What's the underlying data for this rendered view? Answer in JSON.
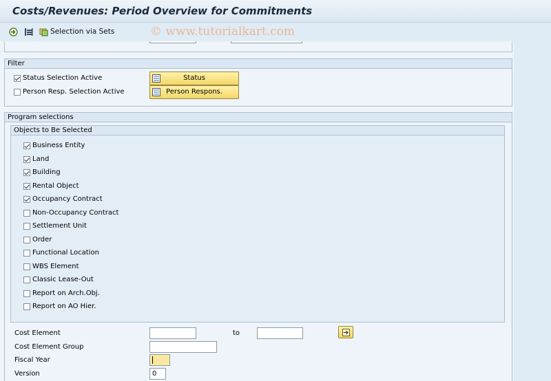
{
  "window": {
    "title": "Costs/Revenues: Period Overview for Commitments"
  },
  "toolbar": {
    "execute_icon": "execute-icon",
    "variant_icon": "get-variant-icon",
    "sets_icon": "selection-via-sets-icon",
    "sets_label": "Selection via Sets",
    "watermark": "© www.tutorialkart.com"
  },
  "filter": {
    "title": "Filter",
    "status_active": {
      "label": "Status Selection Active",
      "checked": true
    },
    "person_active": {
      "label": "Person Resp. Selection Active",
      "checked": false
    },
    "status_button": "Status",
    "person_button": "Person Respons."
  },
  "program": {
    "title": "Program selections",
    "objects_title": "Objects to Be Selected",
    "objects": [
      {
        "label": "Business Entity",
        "checked": true
      },
      {
        "label": "Land",
        "checked": true
      },
      {
        "label": "Building",
        "checked": true
      },
      {
        "label": "Rental Object",
        "checked": true
      },
      {
        "label": "Occupancy Contract",
        "checked": true
      },
      {
        "label": "Non-Occupancy Contract",
        "checked": false
      },
      {
        "label": "Settlement Unit",
        "checked": false
      },
      {
        "label": "Order",
        "checked": false
      },
      {
        "label": "Functional Location",
        "checked": false
      },
      {
        "label": "WBS Element",
        "checked": false
      },
      {
        "label": "Classic Lease-Out",
        "checked": false
      },
      {
        "label": "Report on Arch.Obj.",
        "checked": false
      },
      {
        "label": "Report on AO Hier.",
        "checked": false
      }
    ],
    "cost_element_label": "Cost Element",
    "cost_element_from": "",
    "to_label": "to",
    "cost_element_to": "",
    "cost_element_group_label": "Cost Element Group",
    "cost_element_group": "",
    "fiscal_year_label": "Fiscal Year",
    "fiscal_year": "",
    "version_label": "Version",
    "version": "0"
  },
  "colors": {
    "button": "#f3d768",
    "background": "#dfebf5",
    "frame": "#eef4f9"
  }
}
